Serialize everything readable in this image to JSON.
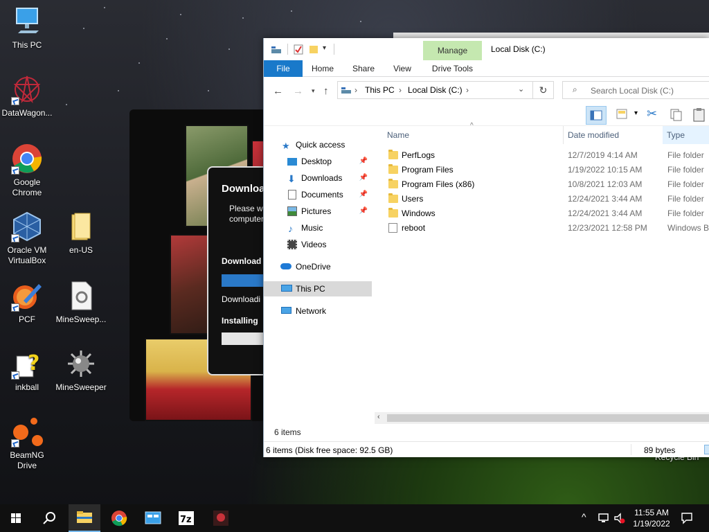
{
  "desktop": {
    "icons": [
      {
        "label": "This PC"
      },
      {
        "label": "DataWagon..."
      },
      {
        "label": "Google Chrome"
      },
      {
        "label": "Oracle VM VirtualBox"
      },
      {
        "label": "en-US"
      },
      {
        "label": "PCF"
      },
      {
        "label": "MineSweep..."
      },
      {
        "label": "inkball"
      },
      {
        "label": "MineSweeper"
      },
      {
        "label": "BeamNG Drive"
      }
    ],
    "recycle_bin_label": "Recycle Bin"
  },
  "installer": {
    "title": "Downloa",
    "message": "Please w computer",
    "download_label": "Download",
    "downloading_label": "Downloadi",
    "installing_label": "Installing"
  },
  "explorer": {
    "window_title": "Local Disk (C:)",
    "context_tab": "Manage",
    "tabs": [
      "File",
      "Home",
      "Share",
      "View",
      "Drive Tools"
    ],
    "address": {
      "segments": [
        "This PC",
        "Local Disk (C:)"
      ]
    },
    "search_placeholder": "Search Local Disk (C:)",
    "nav_pane": {
      "quick_access": "Quick access",
      "items": [
        {
          "label": "Desktop",
          "pinned": true
        },
        {
          "label": "Downloads",
          "pinned": true
        },
        {
          "label": "Documents",
          "pinned": true
        },
        {
          "label": "Pictures",
          "pinned": true
        },
        {
          "label": "Music",
          "pinned": false
        },
        {
          "label": "Videos",
          "pinned": false
        }
      ],
      "onedrive": "OneDrive",
      "this_pc": "This PC",
      "network": "Network"
    },
    "columns": [
      "Name",
      "Date modified",
      "Type"
    ],
    "files": [
      {
        "name": "PerfLogs",
        "date": "12/7/2019 4:14 AM",
        "type": "File folder",
        "kind": "folder"
      },
      {
        "name": "Program Files",
        "date": "1/19/2022 10:15 AM",
        "type": "File folder",
        "kind": "folder"
      },
      {
        "name": "Program Files (x86)",
        "date": "10/8/2021 12:03 AM",
        "type": "File folder",
        "kind": "folder"
      },
      {
        "name": "Users",
        "date": "12/24/2021 3:44 AM",
        "type": "File folder",
        "kind": "folder"
      },
      {
        "name": "Windows",
        "date": "12/24/2021 3:44 AM",
        "type": "File folder",
        "kind": "folder"
      },
      {
        "name": "reboot",
        "date": "12/23/2021 12:58 PM",
        "type": "Windows Ba",
        "kind": "file"
      }
    ],
    "item_count": "6 items",
    "status_left": "6 items (Disk free space: 92.5 GB)",
    "status_right": "89 bytes"
  },
  "taskbar": {
    "time": "11:55 AM",
    "date": "1/19/2022",
    "apps": [
      "file-explorer",
      "chrome",
      "control-panel",
      "7-zip",
      "game"
    ]
  },
  "colors": {
    "accent": "#1979ca",
    "manage_tab": "#c5e8b0",
    "selected_nav": "#d9d9d9"
  }
}
